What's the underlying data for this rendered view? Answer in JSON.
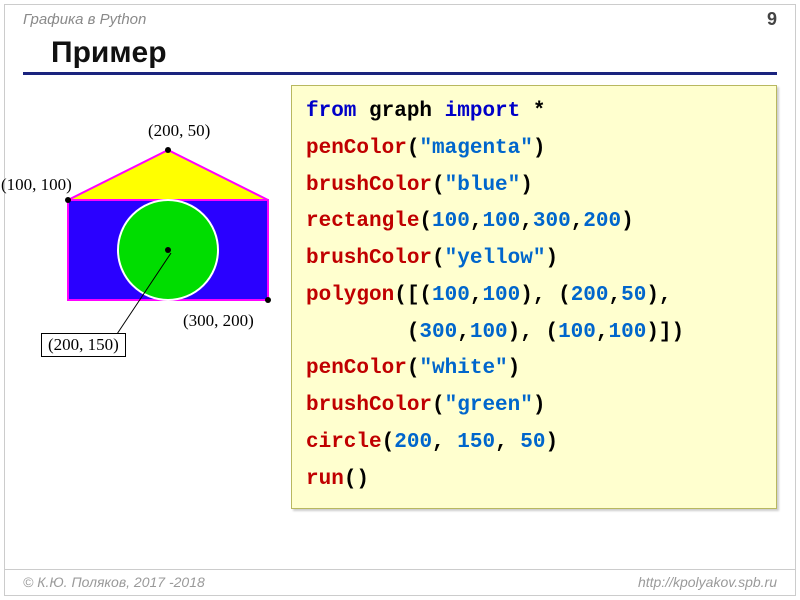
{
  "header": {
    "topic": "Графика в Python",
    "page": "9"
  },
  "title": "Пример",
  "labels": {
    "p1": "(200, 50)",
    "p2": "(100, 100)",
    "p3": "(300, 200)",
    "p4": "(200, 150)"
  },
  "code": {
    "l1_from": "from",
    "l1_graph": " graph ",
    "l1_import": "import",
    "l1_star": " *",
    "l2_fn": "penColor",
    "l2_arg": "\"magenta\"",
    "l3_fn": "brushColor",
    "l3_arg": "\"blue\"",
    "l4_fn": "rectangle",
    "l4_a": "100",
    "l4_b": "100",
    "l4_c": "300",
    "l4_d": "200",
    "l5_fn": "brushColor",
    "l5_arg": "\"yellow\"",
    "l6_fn": "polygon",
    "l6_a": "100",
    "l6_b": "100",
    "l6_c": "200",
    "l6_d": "50",
    "l7_a": "300",
    "l7_b": "100",
    "l7_c": "100",
    "l7_d": "100",
    "l8_fn": "penColor",
    "l8_arg": "\"white\"",
    "l9_fn": "brushColor",
    "l9_arg": "\"green\"",
    "l10_fn": "circle",
    "l10_a": "200",
    "l10_b": "150",
    "l10_c": "50",
    "l11_fn": "run"
  },
  "footer": {
    "author": "© К.Ю. Поляков, 2017 -2018",
    "url": "http://kpolyakov.spb.ru"
  }
}
